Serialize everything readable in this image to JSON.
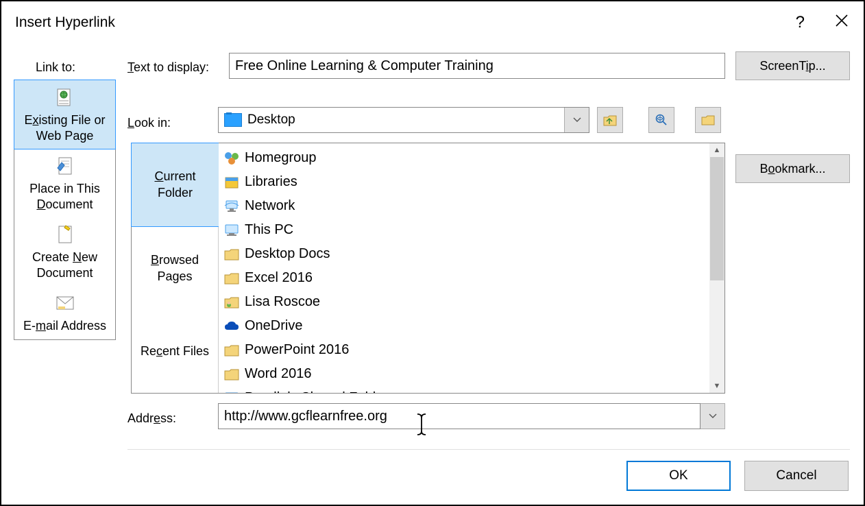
{
  "title": "Insert Hyperlink",
  "linkto_label": "Link to:",
  "linkto_items": [
    {
      "label": "Existing File or Web Page",
      "selected": true
    },
    {
      "label": "Place in This Document",
      "selected": false
    },
    {
      "label": "Create New Document",
      "selected": false
    },
    {
      "label": "E-mail Address",
      "selected": false
    }
  ],
  "text_to_display": {
    "label_pre": "T",
    "label_post": "ext to display:",
    "value": "Free Online Learning & Computer Training"
  },
  "screentip_label": "ScreenTip...",
  "bookmark_label": "Bookmark...",
  "lookin": {
    "label": "Look in:",
    "value": "Desktop"
  },
  "browse_tabs": [
    {
      "pre": "C",
      "post": "urrent Folder",
      "selected": true
    },
    {
      "pre": "B",
      "post": "rowsed Pages",
      "selected": false
    },
    {
      "pre": "Re",
      "post": "cent Files",
      "u": "c",
      "selected": false
    }
  ],
  "files": [
    {
      "name": "Homegroup",
      "icon": "homegroup"
    },
    {
      "name": "Libraries",
      "icon": "libraries"
    },
    {
      "name": "Network",
      "icon": "network"
    },
    {
      "name": "This PC",
      "icon": "pc"
    },
    {
      "name": "Desktop Docs",
      "icon": "folder"
    },
    {
      "name": "Excel 2016",
      "icon": "folder"
    },
    {
      "name": "Lisa Roscoe",
      "icon": "userfolder"
    },
    {
      "name": "OneDrive",
      "icon": "onedrive"
    },
    {
      "name": "PowerPoint 2016",
      "icon": "folder"
    },
    {
      "name": "Word 2016",
      "icon": "folder"
    },
    {
      "name": "Parallels Shared Folders",
      "icon": "pc"
    }
  ],
  "address": {
    "label_pre": "Addr",
    "label_u": "e",
    "label_post": "ss:",
    "value": "http://www.gcflearnfree.org"
  },
  "ok_label": "OK",
  "cancel_label": "Cancel",
  "underline_map": {
    "Place in This Document": 14,
    "Create New Document": 7,
    "E-mail Address": 2,
    "ScreenTip...": 7,
    "Bookmark...": 1,
    "Look in:": 0,
    "Existing File or Web Page": 1
  }
}
